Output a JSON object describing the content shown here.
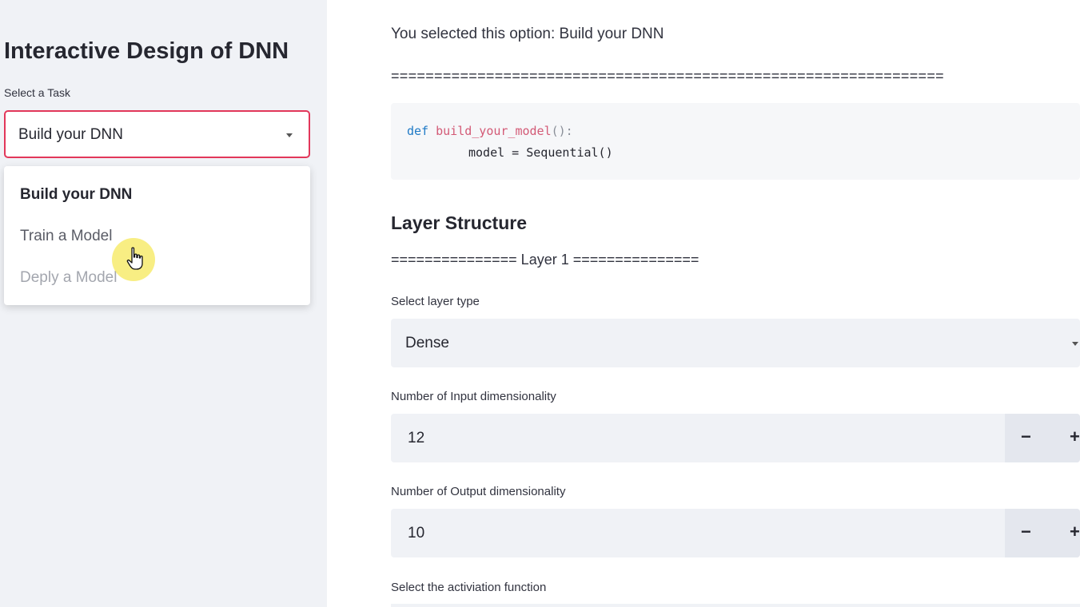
{
  "sidebar": {
    "title": "Interactive Design of DNN",
    "task_label": "Select a Task",
    "task_value": "Build your DNN",
    "options": [
      "Build your DNN",
      "Train a Model",
      "Deply a Model"
    ]
  },
  "main": {
    "selected_text": "You selected this option: Build your DNN",
    "separator": "================================================================",
    "code": {
      "keyword": "def",
      "function_name": "build_your_model",
      "parens": "():",
      "line2": "model = Sequential()"
    },
    "layer_heading": "Layer Structure",
    "layer_separator": "=============== Layer 1 ===============",
    "layer_type_label": "Select layer type",
    "layer_type_value": "Dense",
    "input_dim_label": "Number of Input dimensionality",
    "input_dim_value": "12",
    "output_dim_label": "Number of Output dimensionality",
    "output_dim_value": "10",
    "activation_label": "Select the activiation function",
    "minus_label": "−",
    "plus_label": "+"
  },
  "colors": {
    "accent": "#e2375a",
    "sidebar_bg": "#f0f2f6",
    "cursor_highlight": "#f6e85a"
  },
  "icons": {
    "dropdown": "chevron-down-icon",
    "cursor": "hand-pointer-icon"
  }
}
